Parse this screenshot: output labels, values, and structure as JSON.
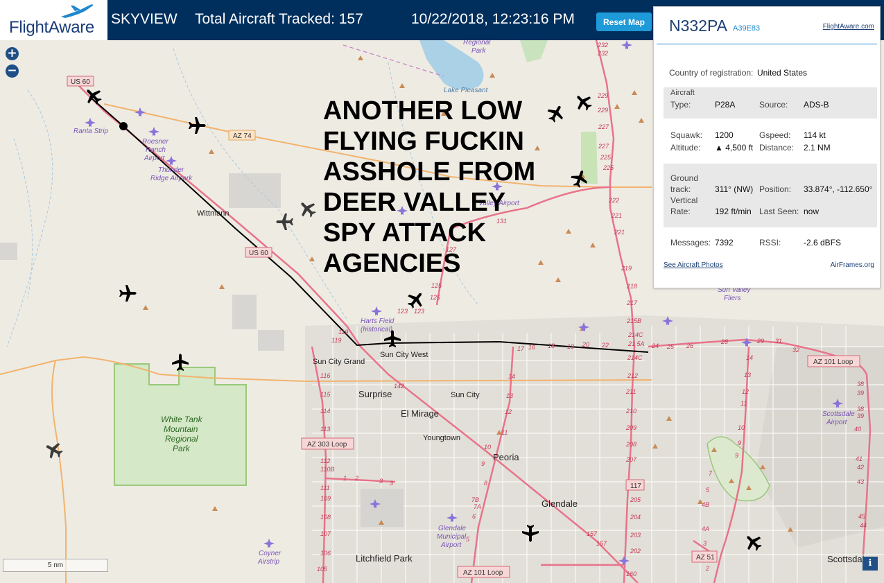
{
  "header": {
    "logo_text": "FlightAware",
    "app_name": "SKYVIEW",
    "total_tracked": "Total Aircraft Tracked: 157",
    "datetime": "10/22/2018, 12:23:16 PM",
    "reset_button": "Reset Map"
  },
  "overlay_text": [
    "ANOTHER LOW",
    "FLYING FUCKIN",
    "ASSHOLE FROM",
    "DEER VALLEY",
    "SPY ATTACK",
    "AGENCIES"
  ],
  "panel": {
    "registration": "N332PA",
    "hex": "A39E83",
    "flightaware_link": "FlightAware.com",
    "country_label": "Country of registration:",
    "country_value": "United States",
    "aircraft_type_label_1": "Aircraft",
    "aircraft_type_label_2": "Type:",
    "aircraft_type": "P28A",
    "source_label": "Source:",
    "source": "ADS-B",
    "squawk_label": "Squawk:",
    "squawk": "1200",
    "gspeed_label": "Gspeed:",
    "gspeed": "114 kt",
    "altitude_label": "Altitude:",
    "altitude": "▲ 4,500 ft",
    "distance_label": "Distance:",
    "distance": "2.1 NM",
    "ground_track_label_1": "Ground",
    "ground_track_label_2": "track:",
    "ground_track": "311° (NW)",
    "position_label": "Position:",
    "position": "33.874°, -112.650°",
    "vertical_rate_label_1": "Vertical",
    "vertical_rate_label_2": "Rate:",
    "vertical_rate": "192 ft/min",
    "last_seen_label": "Last Seen:",
    "last_seen": "now",
    "messages_label": "Messages:",
    "messages": "7392",
    "rssi_label": "RSSI:",
    "rssi": "-2.6 dBFS",
    "photos_link": "See Aircraft Photos",
    "airframes_link": "AirFrames.org"
  },
  "map": {
    "zoom_in": "+",
    "zoom_out": "−",
    "scale_label": "5 nm",
    "info": "i",
    "places": {
      "regional_park": "Regional",
      "park_1": "Park",
      "lake_pleasant": "Lake Pleasant",
      "ranta_strip": "Ranta Strip",
      "roesner_1": "Roesner",
      "roesner_2": "Ranch",
      "roesner_3": "Airport",
      "thunder_1": "Thunder",
      "thunder_2": "Ridge Airpark",
      "wittmann": "Wittmann",
      "harts_1": "Harts Field",
      "harts_2": "(historical)",
      "sun_city_grand": "Sun City Grand",
      "sun_city_west": "Sun City West",
      "surprise": "Surprise",
      "sun_city": "Sun City",
      "el_mirage": "El Mirage",
      "youngtown": "Youngtown",
      "peoria": "Peoria",
      "glendale": "Glendale",
      "glendale_airport_1": "Glendale",
      "glendale_airport_2": "Municipal",
      "glendale_airport_3": "Airport",
      "litchfield_park": "Litchfield Park",
      "coyner_1": "Coyner",
      "coyner_2": "Airstrip",
      "wt_1": "White Tank",
      "wt_2": "Mountain",
      "wt_3": "Regional",
      "wt_4": "Park",
      "scottsdale": "Scottsdale",
      "scottsdale_airport_1": "Scottsdale",
      "scottsdale_airport_2": "Airport",
      "sun_valley_1": "Sun Valley",
      "sun_valley_2": "Fliers",
      "valley_airport": "Valley Airport"
    },
    "shields": {
      "us60_a": "US 60",
      "us60_b": "US 60",
      "az74": "AZ 74",
      "az303": "AZ 303 Loop",
      "az101_a": "AZ 101 Loop",
      "az101_b": "AZ 101 Loop",
      "az51": "AZ 51",
      "r117": "117"
    },
    "colors": {
      "road_major": "#e8738a",
      "road_secondary": "#f2b36e",
      "park_green": "#9ac87c",
      "track_line": "#000000"
    }
  }
}
